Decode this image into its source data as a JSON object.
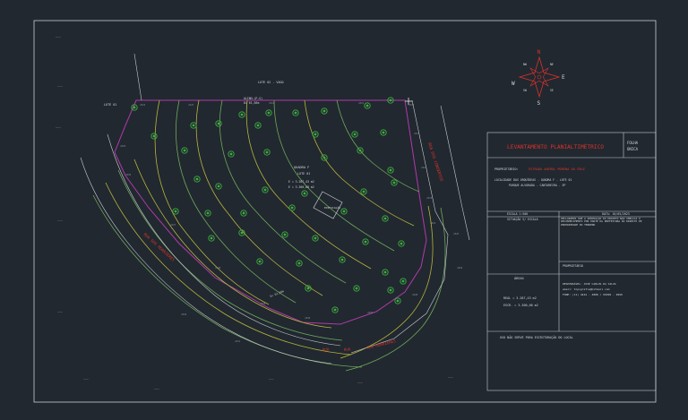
{
  "colors": {
    "background": "#212830",
    "sheet_border": "#c9ccd0",
    "text": "#d6d6d6",
    "accent_red": "#d9332b",
    "contour_yellow": "#b8b43c",
    "contour_green": "#6fa85a",
    "boundary_magenta": "#b03aa8",
    "tree_green": "#3fae3f"
  },
  "drawing": {
    "top_label": "LOTE 02 - VAGO",
    "left_label": "LOTE 01",
    "top_dim": "ALINH.(P.S)",
    "top_dim2": "D= 61,56m",
    "block": "QUADRA F",
    "lot": "LOTE 01",
    "area_line1": "E = 3.287,43 m2",
    "area_line2": "E = 3.300,00 m2",
    "building": "EDIFICAÇÃO",
    "road_right": "RUA DOS CONSERTOS",
    "road_left": "RUA DOS MORRIERES",
    "road_bottom_a": "RUA",
    "road_bottom_b": "RUA",
    "road_bottom_c": "RUA MORRIERES",
    "bottom_dim": "D= 61,56m"
  },
  "compass": {
    "north": "N",
    "south": "S",
    "east": "E",
    "west": "W",
    "ne": "NE",
    "nw": "NW",
    "se": "SE",
    "sw": "SW"
  },
  "title_block": {
    "title": "LEVANTAMENTO PLANIALTIMÉTRICO",
    "folha": "FOLHA",
    "folha_num": "ÚNICA",
    "owner_label": "PROPRIETÁRIO:",
    "owner_value": "ESTRADA ANIMAL MORENA DA CRUZ",
    "location1": "LOCALIDADE DAS ORQUÍDEAS - QUADRA F - LOTE 01",
    "location2": "PARQUE ALVORADA - CANTAREIRA - SP",
    "escala": "ESCALA 1:500",
    "data": "DATA: 10/05/2023",
    "situacao": "SITUAÇÃO S/ ESCALA",
    "declaration": "DECLARAMOS QUE A APROVAÇÃO DO PROJETO NÃO IMPLICA O RECONHECIMENTO POR PARTE DA PREFEITURA DO DIREITO DE PROPRIEDADE DO TERRENO",
    "proprietario": "PROPRIETÁRIO",
    "areas_label": "ÁREAS",
    "area_real": "REAL = 3.287,43 m2",
    "area_escr": "ESCR. = 3.300,00 m2",
    "resp1": "RESPONSÁVEL: JOSÉ CARLOS DA SILVA",
    "resp2": "email: topografia@hotmail.com",
    "resp3": "FONE: (11) 4444 - 4888 / 99999 - 9999",
    "footer": "USO NÃO SERVE PARA ESCRITURAÇÃO DO LOCAL"
  }
}
